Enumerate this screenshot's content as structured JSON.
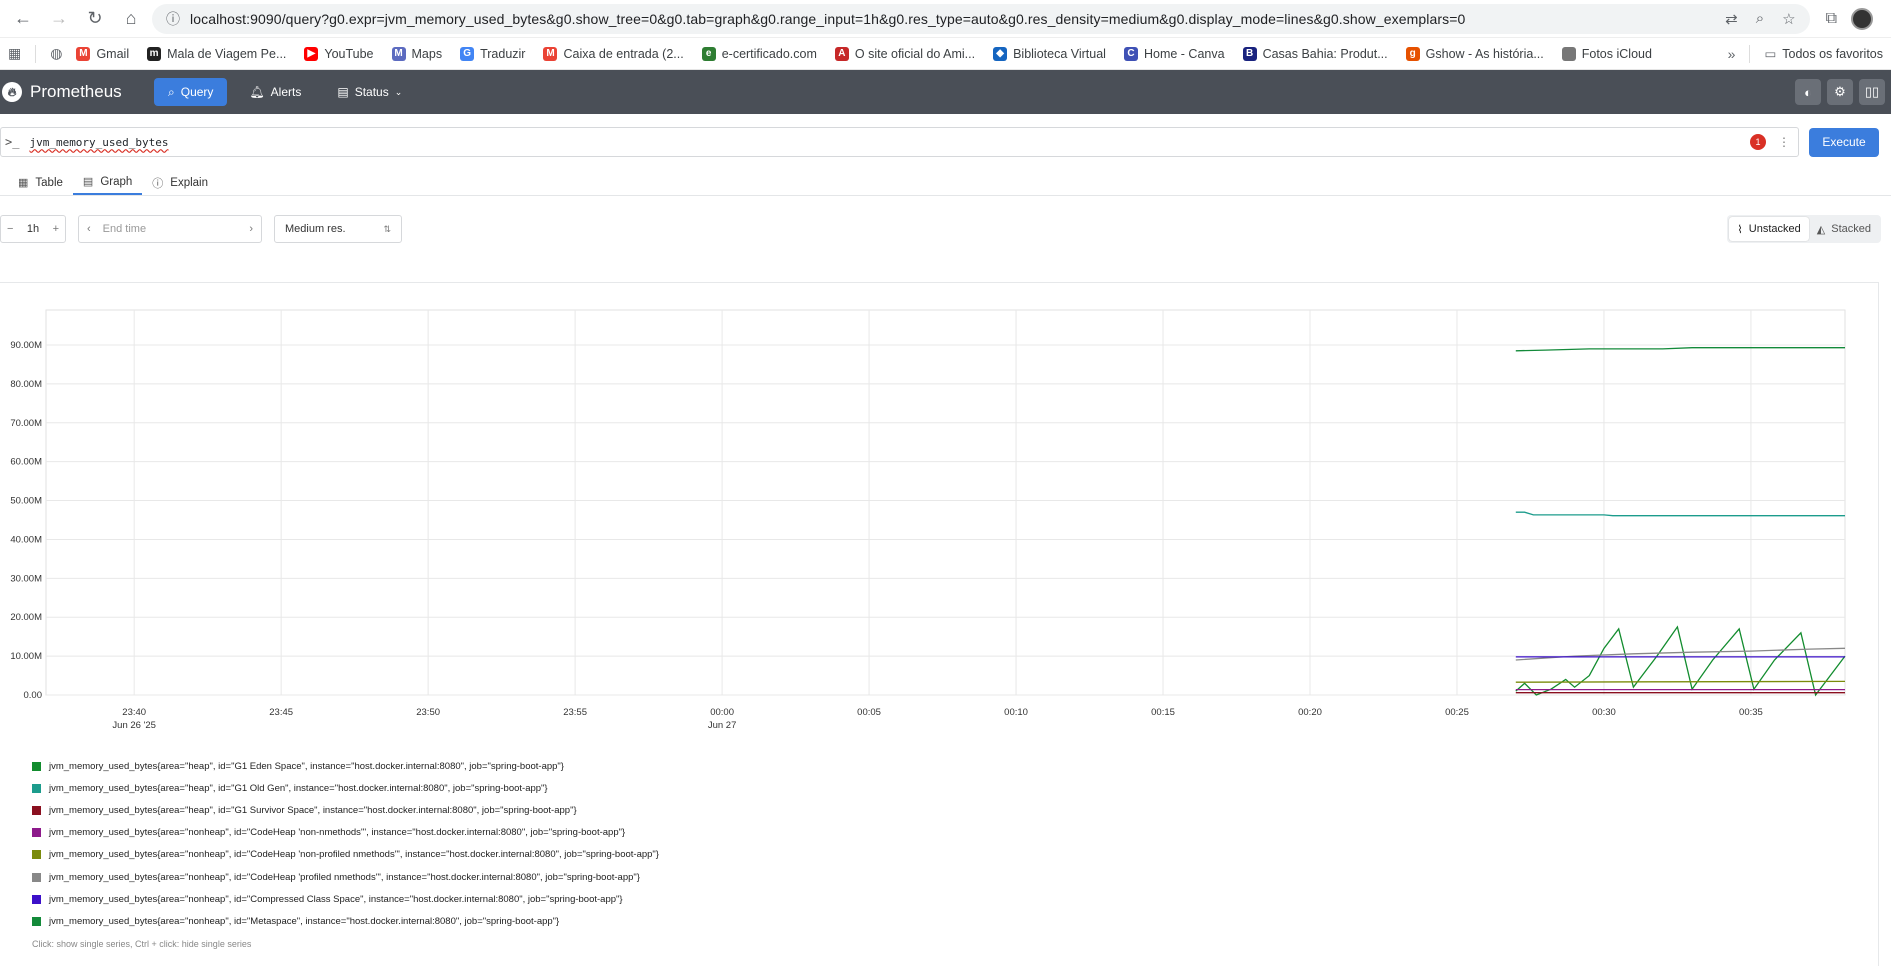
{
  "browser": {
    "url": "localhost:9090/query?g0.expr=jvm_memory_used_bytes&g0.show_tree=0&g0.tab=graph&g0.range_input=1h&g0.res_type=auto&g0.res_density=medium&g0.display_mode=lines&g0.show_exemplars=0",
    "bookmarks": [
      {
        "label": "Gmail",
        "icon": "gmail-icon",
        "color": "#ea4335",
        "glyph": "M"
      },
      {
        "label": "Mala de Viagem Pe...",
        "icon": "mala-icon",
        "color": "#222222",
        "glyph": "m"
      },
      {
        "label": "YouTube",
        "icon": "youtube-icon",
        "color": "#ff0000",
        "glyph": "▶"
      },
      {
        "label": "Maps",
        "icon": "maps-icon",
        "color": "#5c6bc0",
        "glyph": "M"
      },
      {
        "label": "Traduzir",
        "icon": "translate-icon",
        "color": "#4285f4",
        "glyph": "G"
      },
      {
        "label": "Caixa de entrada (2...",
        "icon": "gmail-icon",
        "color": "#ea4335",
        "glyph": "M"
      },
      {
        "label": "e-certificado.com",
        "icon": "certificado-icon",
        "color": "#2e7d32",
        "glyph": "e"
      },
      {
        "label": "O site oficial do Ami...",
        "icon": "amigurumi-icon",
        "color": "#c62828",
        "glyph": "A"
      },
      {
        "label": "Biblioteca Virtual",
        "icon": "biblioteca-icon",
        "color": "#1565c0",
        "glyph": "◆"
      },
      {
        "label": "Home - Canva",
        "icon": "canva-icon",
        "color": "#3f51b5",
        "glyph": "C"
      },
      {
        "label": "Casas Bahia: Produt...",
        "icon": "casas-bahia-icon",
        "color": "#1a237e",
        "glyph": "B"
      },
      {
        "label": "Gshow - As história...",
        "icon": "gshow-icon",
        "color": "#e65100",
        "glyph": "g"
      },
      {
        "label": "Fotos iCloud",
        "icon": "apple-icon",
        "color": "#777777",
        "glyph": ""
      }
    ],
    "all_bookmarks": "Todos os favoritos"
  },
  "header": {
    "app_name": "Prometheus",
    "nav": [
      {
        "label": "Query",
        "active": true
      },
      {
        "label": "Alerts",
        "active": false
      },
      {
        "label": "Status",
        "active": false
      }
    ]
  },
  "query": {
    "expression": "jvm_memory_used_bytes",
    "error_count": "1",
    "execute_label": "Execute"
  },
  "tabs": [
    {
      "label": "Table"
    },
    {
      "label": "Graph"
    },
    {
      "label": "Explain"
    }
  ],
  "controls": {
    "range": "1h",
    "end_time_placeholder": "End time",
    "resolution": "Medium res.",
    "unstacked_label": "Unstacked",
    "stacked_label": "Stacked"
  },
  "chart_data": {
    "type": "line",
    "yticks": [
      "0.00",
      "10.00M",
      "20.00M",
      "30.00M",
      "40.00M",
      "50.00M",
      "60.00M",
      "70.00M",
      "80.00M",
      "90.00M"
    ],
    "ylim": [
      0,
      90000000
    ],
    "xticks": [
      {
        "label": "23:40",
        "sub": "Jun 26 '25"
      },
      {
        "label": "23:45",
        "sub": ""
      },
      {
        "label": "23:50",
        "sub": ""
      },
      {
        "label": "23:55",
        "sub": ""
      },
      {
        "label": "00:00",
        "sub": "Jun 27"
      },
      {
        "label": "00:05",
        "sub": ""
      },
      {
        "label": "00:10",
        "sub": ""
      },
      {
        "label": "00:15",
        "sub": ""
      },
      {
        "label": "00:20",
        "sub": ""
      },
      {
        "label": "00:25",
        "sub": ""
      },
      {
        "label": "00:30",
        "sub": ""
      },
      {
        "label": "00:35",
        "sub": ""
      }
    ],
    "x_domain_minutes": [
      -23,
      38.2
    ],
    "series": [
      {
        "name": "jvm_memory_used_bytes{area=\"heap\", id=\"G1 Eden Space\", instance=\"host.docker.internal:8080\", job=\"spring-boot-app\"}",
        "color": "#128c2e",
        "points": [
          [
            27.0,
            1000000
          ],
          [
            27.3,
            3000000
          ],
          [
            27.7,
            0
          ],
          [
            28.2,
            1500000
          ],
          [
            28.7,
            4000000
          ],
          [
            29.0,
            2000000
          ],
          [
            29.5,
            5000000
          ],
          [
            30.0,
            12000000
          ],
          [
            30.5,
            17000000
          ],
          [
            31.0,
            2000000
          ],
          [
            31.8,
            10000000
          ],
          [
            32.5,
            17500000
          ],
          [
            33.0,
            1500000
          ],
          [
            33.7,
            9000000
          ],
          [
            34.6,
            17000000
          ],
          [
            35.1,
            1500000
          ],
          [
            35.8,
            9000000
          ],
          [
            36.7,
            16000000
          ],
          [
            37.2,
            0
          ],
          [
            38.2,
            10000000
          ]
        ]
      },
      {
        "name": "jvm_memory_used_bytes{area=\"heap\", id=\"G1 Old Gen\", instance=\"host.docker.internal:8080\", job=\"spring-boot-app\"}",
        "color": "#1c9c8c",
        "points": [
          [
            27.0,
            47000000
          ],
          [
            27.3,
            47000000
          ],
          [
            27.6,
            46300000
          ],
          [
            30.0,
            46300000
          ],
          [
            30.3,
            46100000
          ],
          [
            38.2,
            46100000
          ]
        ]
      },
      {
        "name": "jvm_memory_used_bytes{area=\"heap\", id=\"G1 Survivor Space\", instance=\"host.docker.internal:8080\", job=\"spring-boot-app\"}",
        "color": "#8a0f1f",
        "points": [
          [
            27.0,
            600000
          ],
          [
            38.2,
            600000
          ]
        ]
      },
      {
        "name": "jvm_memory_used_bytes{area=\"nonheap\", id=\"CodeHeap 'non-nmethods'\", instance=\"host.docker.internal:8080\", job=\"spring-boot-app\"}",
        "color": "#8d1a8b",
        "points": [
          [
            27.0,
            1400000
          ],
          [
            38.2,
            1400000
          ]
        ]
      },
      {
        "name": "jvm_memory_used_bytes{area=\"nonheap\", id=\"CodeHeap 'non-profiled nmethods'\", instance=\"host.docker.internal:8080\", job=\"spring-boot-app\"}",
        "color": "#7a8b0c",
        "points": [
          [
            27.0,
            3300000
          ],
          [
            32.0,
            3400000
          ],
          [
            38.2,
            3500000
          ]
        ]
      },
      {
        "name": "jvm_memory_used_bytes{area=\"nonheap\", id=\"CodeHeap 'profiled nmethods'\", instance=\"host.docker.internal:8080\", job=\"spring-boot-app\"}",
        "color": "#888888",
        "points": [
          [
            27.0,
            9000000
          ],
          [
            29.0,
            10000000
          ],
          [
            31.0,
            10600000
          ],
          [
            33.0,
            11000000
          ],
          [
            35.0,
            11300000
          ],
          [
            37.0,
            11800000
          ],
          [
            38.2,
            12000000
          ]
        ]
      },
      {
        "name": "jvm_memory_used_bytes{area=\"nonheap\", id=\"Compressed Class Space\", instance=\"host.docker.internal:8080\", job=\"spring-boot-app\"}",
        "color": "#3c10c9",
        "points": [
          [
            27.0,
            9800000
          ],
          [
            38.2,
            9800000
          ]
        ]
      },
      {
        "name": "jvm_memory_used_bytes{area=\"nonheap\", id=\"Metaspace\", instance=\"host.docker.internal:8080\", job=\"spring-boot-app\"}",
        "color": "#138a3a",
        "points": [
          [
            27.0,
            88500000
          ],
          [
            28.0,
            88700000
          ],
          [
            29.5,
            89000000
          ],
          [
            32.0,
            89000000
          ],
          [
            33.0,
            89300000
          ],
          [
            38.2,
            89300000
          ]
        ]
      }
    ]
  },
  "legend_hint": "Click: show single series, Ctrl + click: hide single series"
}
